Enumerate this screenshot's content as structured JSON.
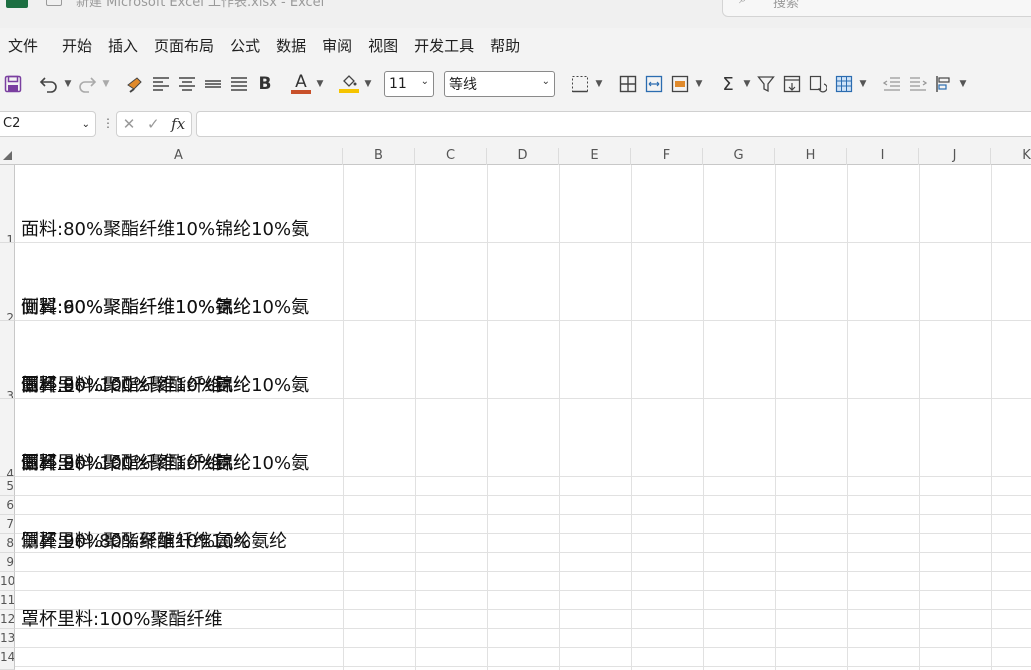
{
  "titlebar": {
    "title": "新建 Microsoft Excel 工作表.xlsx - Excel",
    "search_placeholder": "搜索",
    "search_icon": "search-icon"
  },
  "menu": [
    "文件",
    "开始",
    "插入",
    "页面布局",
    "公式",
    "数据",
    "审阅",
    "视图",
    "开发工具",
    "帮助"
  ],
  "toolbar": {
    "font_size": "11",
    "font_name": "等线",
    "bold_label": "B",
    "font_color_label": "A",
    "colors": {
      "font_color": "#d9534f",
      "fill_color": "#ffd700",
      "save": "#7a3fa0"
    }
  },
  "formula_bar": {
    "name_box": "C2",
    "formula": "",
    "fx_label": "fx"
  },
  "sheet": {
    "columns": [
      "A",
      "B",
      "C",
      "D",
      "E",
      "F",
      "G",
      "H",
      "I",
      "J",
      "K"
    ],
    "rows": [
      {
        "num": "1",
        "A": [
          "面料:80%聚酯纤维10%锦纶10%氨",
          "侧翼:90%聚酯纤维10%氨纶",
          "罩杯里料:100%聚酯纤维"
        ]
      },
      {
        "num": "2",
        "A": [
          "面料:60%聚酯纤维10%锦纶10%氨",
          "侧翼:90%聚酯纤维10%氨纶",
          "罩杯里料:100%聚酯纤维"
        ]
      },
      {
        "num": "3",
        "A": [
          "面料:80%聚酯纤维10%锦纶10%氨",
          "侧翼:90%聚酯纤维10%氨纶",
          "罩杯里料:80%聚酯纤维10%氨纶"
        ]
      },
      {
        "num": "4",
        "A": [
          "面料:80%聚酯纤维10%锦纶10%氨",
          "侧翼:90%聚酯纤维10%氨纶",
          "罩杯里料:100%聚酯纤维"
        ]
      }
    ],
    "empty_rows": [
      "5",
      "6",
      "7",
      "8",
      "9",
      "10",
      "11",
      "12",
      "13",
      "14"
    ]
  }
}
